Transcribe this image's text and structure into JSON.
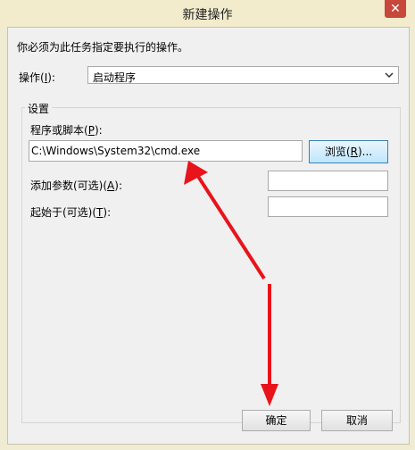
{
  "window": {
    "title": "新建操作",
    "close_glyph": "✕"
  },
  "instruction": "你必须为此任务指定要执行的操作。",
  "action": {
    "label_prefix": "操作(",
    "label_key": "I",
    "label_suffix": "):",
    "value": "启动程序"
  },
  "settings": {
    "group_label": "设置",
    "program": {
      "label_prefix": "程序或脚本(",
      "label_key": "P",
      "label_suffix": "):",
      "value": "C:\\Windows\\System32\\cmd.exe"
    },
    "browse": {
      "label_prefix": "浏览(",
      "label_key": "R",
      "label_suffix": ")..."
    },
    "args": {
      "label_prefix": "添加参数(可选)(",
      "label_key": "A",
      "label_suffix": "):",
      "value": ""
    },
    "start_in": {
      "label_prefix": "起始于(可选)(",
      "label_key": "T",
      "label_suffix": "):",
      "value": ""
    }
  },
  "buttons": {
    "ok": "确定",
    "cancel": "取消"
  },
  "annotations": {
    "arrow_color": "#e8131b"
  }
}
